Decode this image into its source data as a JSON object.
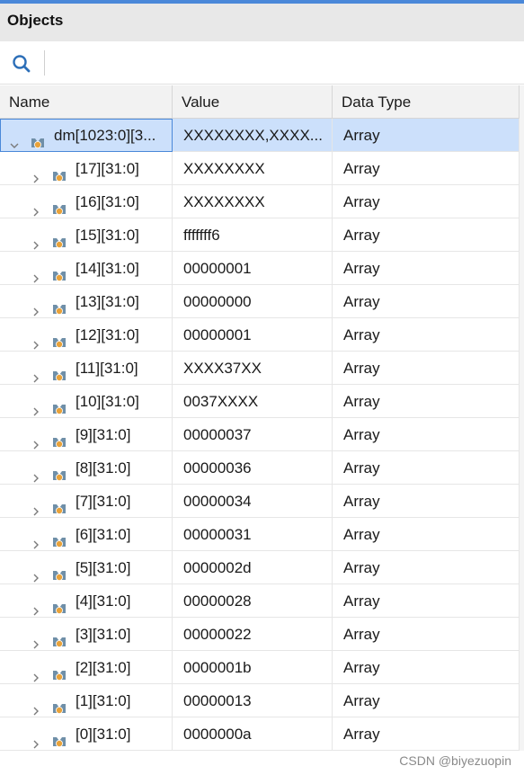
{
  "panel": {
    "title": "Objects"
  },
  "toolbar": {
    "search_icon": "search-icon"
  },
  "columns": {
    "name": "Name",
    "value": "Value",
    "type": "Data Type"
  },
  "rows": [
    {
      "name": "dm[1023:0][3...",
      "value": "XXXXXXXX,XXXX...",
      "type": "Array",
      "level": 0,
      "expanded": true,
      "selected": true
    },
    {
      "name": "[17][31:0]",
      "value": "XXXXXXXX",
      "type": "Array",
      "level": 1,
      "expanded": false,
      "selected": false
    },
    {
      "name": "[16][31:0]",
      "value": "XXXXXXXX",
      "type": "Array",
      "level": 1,
      "expanded": false,
      "selected": false
    },
    {
      "name": "[15][31:0]",
      "value": "fffffff6",
      "type": "Array",
      "level": 1,
      "expanded": false,
      "selected": false
    },
    {
      "name": "[14][31:0]",
      "value": "00000001",
      "type": "Array",
      "level": 1,
      "expanded": false,
      "selected": false
    },
    {
      "name": "[13][31:0]",
      "value": "00000000",
      "type": "Array",
      "level": 1,
      "expanded": false,
      "selected": false
    },
    {
      "name": "[12][31:0]",
      "value": "00000001",
      "type": "Array",
      "level": 1,
      "expanded": false,
      "selected": false
    },
    {
      "name": "[11][31:0]",
      "value": "XXXX37XX",
      "type": "Array",
      "level": 1,
      "expanded": false,
      "selected": false
    },
    {
      "name": "[10][31:0]",
      "value": "0037XXXX",
      "type": "Array",
      "level": 1,
      "expanded": false,
      "selected": false
    },
    {
      "name": "[9][31:0]",
      "value": "00000037",
      "type": "Array",
      "level": 1,
      "expanded": false,
      "selected": false
    },
    {
      "name": "[8][31:0]",
      "value": "00000036",
      "type": "Array",
      "level": 1,
      "expanded": false,
      "selected": false
    },
    {
      "name": "[7][31:0]",
      "value": "00000034",
      "type": "Array",
      "level": 1,
      "expanded": false,
      "selected": false
    },
    {
      "name": "[6][31:0]",
      "value": "00000031",
      "type": "Array",
      "level": 1,
      "expanded": false,
      "selected": false
    },
    {
      "name": "[5][31:0]",
      "value": "0000002d",
      "type": "Array",
      "level": 1,
      "expanded": false,
      "selected": false
    },
    {
      "name": "[4][31:0]",
      "value": "00000028",
      "type": "Array",
      "level": 1,
      "expanded": false,
      "selected": false
    },
    {
      "name": "[3][31:0]",
      "value": "00000022",
      "type": "Array",
      "level": 1,
      "expanded": false,
      "selected": false
    },
    {
      "name": "[2][31:0]",
      "value": "0000001b",
      "type": "Array",
      "level": 1,
      "expanded": false,
      "selected": false
    },
    {
      "name": "[1][31:0]",
      "value": "00000013",
      "type": "Array",
      "level": 1,
      "expanded": false,
      "selected": false
    },
    {
      "name": "[0][31:0]",
      "value": "0000000a",
      "type": "Array",
      "level": 1,
      "expanded": false,
      "selected": false
    }
  ],
  "watermark": "CSDN @biyezuopin",
  "colors": {
    "accent": "#4a88d9",
    "selected_row": "#cce0fb",
    "icon_body": "#6f8fa8",
    "icon_badge": "#e8a23a"
  }
}
